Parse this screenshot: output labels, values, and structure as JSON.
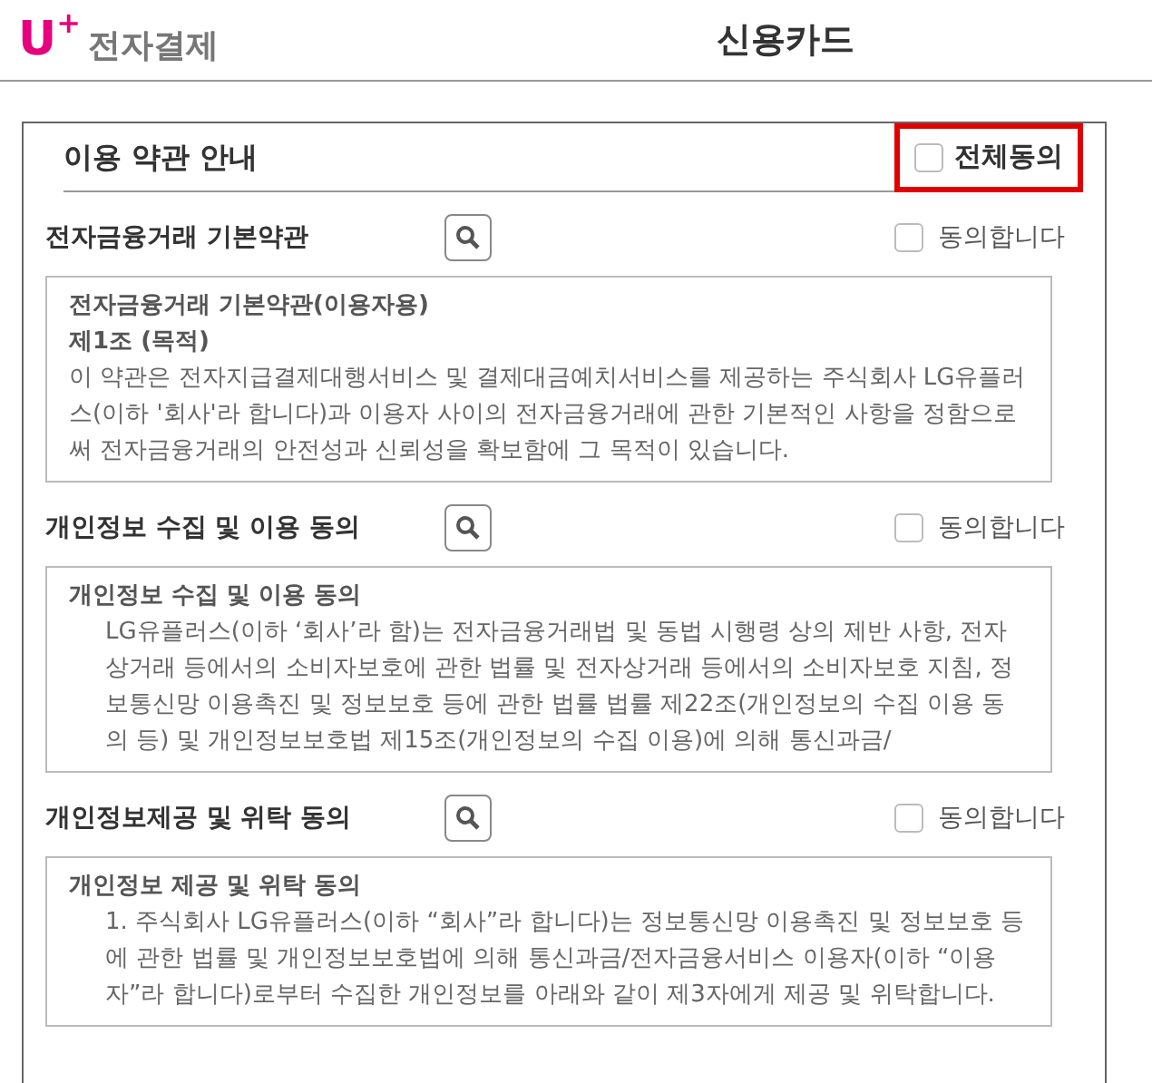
{
  "header": {
    "logo_mark": "U",
    "logo_plus": "+",
    "logo_text": "전자결제",
    "title": "신용카드"
  },
  "terms": {
    "title": "이용 약관 안내",
    "agree_all": {
      "label": "전체동의",
      "checked": false,
      "highlighted": true
    },
    "sections": [
      {
        "title": "전자금융거래 기본약관",
        "agree_label": "동의합니다",
        "checked": false,
        "content": [
          {
            "kind": "heading",
            "text": "전자금융거래 기본약관(이용자용)"
          },
          {
            "kind": "heading",
            "text": "제1조 (목적)"
          },
          {
            "kind": "body",
            "text": "이 약관은 전자지급결제대행서비스 및 결제대금예치서비스를 제공하는 주식회사 LG유플러스(이하 '회사'라 합니다)과 이용자 사이의 전자금융거래에 관한 기본적인 사항을 정함으로써 전자금융거래의 안전성과 신뢰성을 확보함에 그 목적이 있습니다."
          }
        ]
      },
      {
        "title": "개인정보 수집 및 이용 동의",
        "agree_label": "동의합니다",
        "checked": false,
        "content": [
          {
            "kind": "heading",
            "text": "개인정보 수집 및 이용 동의"
          },
          {
            "kind": "indented",
            "text": "LG유플러스(이하 ‘회사’라 함)는 전자금융거래법 및 동법 시행령 상의 제반 사항, 전자상거래 등에서의 소비자보호에 관한 법률 및 전자상거래 등에서의 소비자보호 지침, 정보통신망 이용촉진 및 정보보호 등에 관한 법률 법률 제22조(개인정보의 수집 이용 동의 등) 및 개인정보보호법 제15조(개인정보의 수집 이용)에 의해 통신과금/"
          }
        ]
      },
      {
        "title": "개인정보제공 및 위탁 동의",
        "agree_label": "동의합니다",
        "checked": false,
        "content": [
          {
            "kind": "heading",
            "text": "개인정보 제공 및 위탁 동의"
          },
          {
            "kind": "indented",
            "text": "1. 주식회사 LG유플러스(이하 “회사”라 합니다)는 정보통신망 이용촉진 및 정보보호 등에 관한 법률 및 개인정보보호법에 의해 통신과금/전자금융서비스 이용자(이하 “이용자”라 합니다)로부터 수집한 개인정보를 아래와 같이 제3자에게 제공 및 위탁합니다."
          }
        ]
      }
    ]
  }
}
